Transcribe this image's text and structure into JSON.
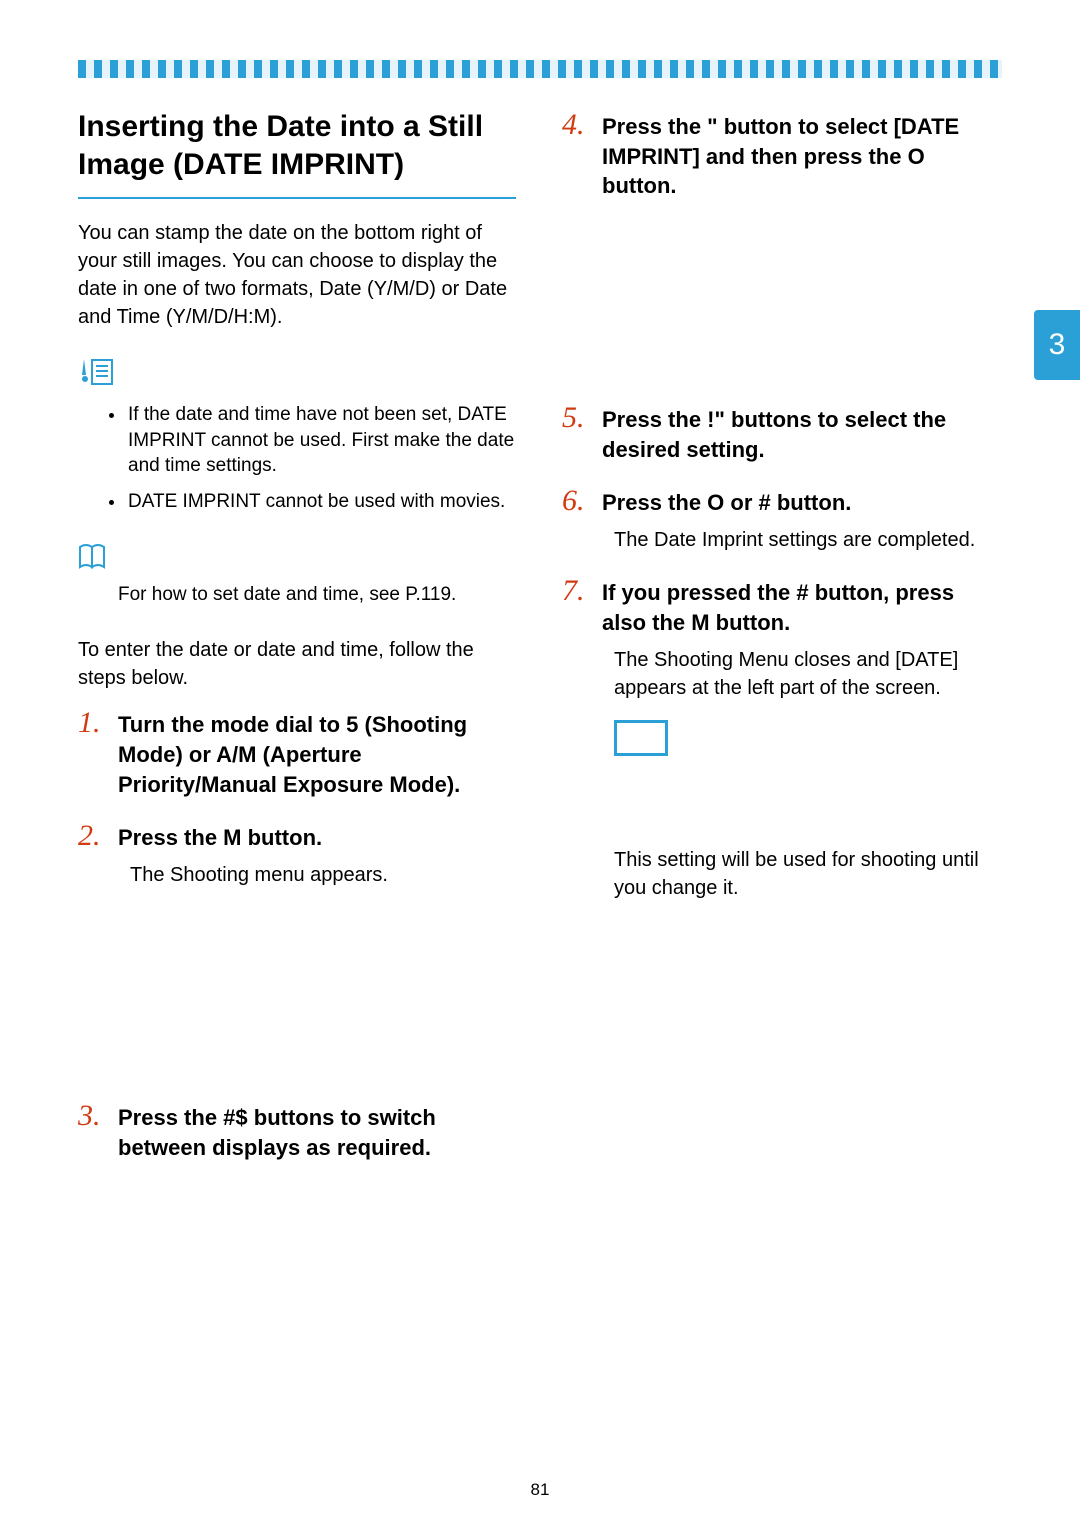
{
  "page_number": "81",
  "side_tab": "3",
  "title": "Inserting the Date into a Still Image (DATE IMPRINT)",
  "intro": "You can stamp the date on the bottom right of your still images. You can choose to display the date in one of two formats, Date (Y/M/D) or Date and Time (Y/M/D/H:M).",
  "notes": [
    "If the date and time have not been set, DATE IMPRINT cannot be used. First make the date and time settings.",
    "DATE IMPRINT cannot be used with movies."
  ],
  "reference": "For how to set date and time, see P.119.",
  "lead": "To enter the date or date and time, follow the steps below.",
  "steps_left": [
    {
      "num": "1.",
      "title": "Turn the mode dial to 5   (Shooting Mode) or A/M (Aperture Priority/Manual Exposure Mode)."
    },
    {
      "num": "2.",
      "title": "Press the M         button.",
      "body": "The Shooting menu appears."
    },
    {
      "num": "3.",
      "title": "Press the #$   buttons to switch between displays as required."
    }
  ],
  "steps_right": [
    {
      "num": "4.",
      "title": "Press the \"   button to select [DATE IMPRINT] and then press the O    button."
    },
    {
      "num": "5.",
      "title": "Press the !\"      buttons to select the desired setting."
    },
    {
      "num": "6.",
      "title": "Press the O    or #  button.",
      "body": "The Date Imprint settings are completed."
    },
    {
      "num": "7.",
      "title": "If you pressed the #  button, press also the M          button.",
      "body": "The Shooting Menu closes and [DATE] appears at the left part of the screen."
    }
  ],
  "closing": "This setting will be used for shooting until you change it."
}
